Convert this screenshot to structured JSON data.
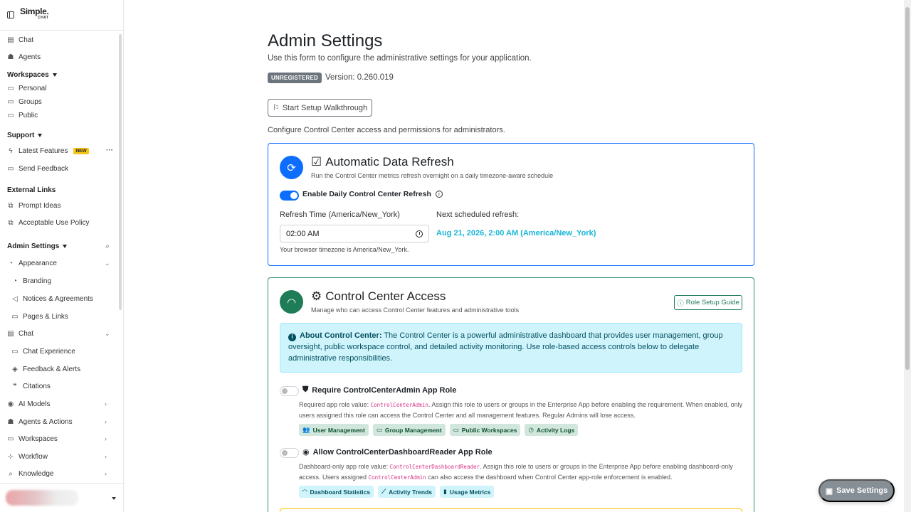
{
  "brand": {
    "line1": "Simple.",
    "line2": "CHAT"
  },
  "sidebar": {
    "chat": "Chat",
    "agents": "Agents",
    "workspaces_header": "Workspaces",
    "personal": "Personal",
    "groups": "Groups",
    "public": "Public",
    "support_header": "Support",
    "latest_features": "Latest Features",
    "new_badge": "NEW",
    "more": "···",
    "send_feedback": "Send Feedback",
    "external_links_header": "External Links",
    "prompt_ideas": "Prompt Ideas",
    "acceptable_use": "Acceptable Use Policy",
    "admin_header": "Admin Settings",
    "appearance": "Appearance",
    "branding": "Branding",
    "notices": "Notices & Agreements",
    "pages_links": "Pages & Links",
    "chat_group": "Chat",
    "chat_experience": "Chat Experience",
    "feedback_alerts": "Feedback & Alerts",
    "citations": "Citations",
    "ai_models": "AI Models",
    "agents_actions": "Agents & Actions",
    "workspaces_group": "Workspaces",
    "workflow": "Workflow",
    "knowledge": "Knowledge"
  },
  "page": {
    "title": "Admin Settings",
    "subtitle": "Use this form to configure the administrative settings for your application.",
    "badge": "UNREGISTERED",
    "version": "Version: 0.260.019",
    "walkthrough": "Start Setup Walkthrough",
    "configure_text": "Configure Control Center access and permissions for administrators."
  },
  "refresh": {
    "title": "Automatic Data Refresh",
    "subtitle": "Run the Control Center metrics refresh overnight on a daily timezone-aware schedule",
    "toggle_label": "Enable Daily Control Center Refresh",
    "toggle_on": true,
    "time_label": "Refresh Time (America/New_York)",
    "time_value": "02:00  AM",
    "browser_tz": "Your browser timezone is America/New_York.",
    "next_label": "Next scheduled refresh:",
    "next_value": "Aug 21, 2026, 2:00 AM (America/New_York)"
  },
  "access": {
    "title": "Control Center Access",
    "subtitle": "Manage who can access Control Center features and administrative tools",
    "guide_button": "Role Setup Guide",
    "alert_bold": "About Control Center:",
    "alert_text": " The Control Center is a powerful administrative dashboard that provides user management, group oversight, public workspace control, and detailed activity monitoring. Use role-based access controls below to delegate administrative responsibilities.",
    "role1": {
      "title": "Require ControlCenterAdmin App Role",
      "enabled": false,
      "text_a": "Required app role value: ",
      "code": "ControlCenterAdmin",
      "text_b": ". Assign this role to users or groups in the Enterprise App before enabling the requirement. When enabled, only users assigned this role can access the Control Center and all management features. Regular Admins will lose access.",
      "pills": [
        "User Management",
        "Group Management",
        "Public Workspaces",
        "Activity Logs"
      ]
    },
    "role2": {
      "title": "Allow ControlCenterDashboardReader App Role",
      "enabled": false,
      "text_a": "Dashboard-only app role value: ",
      "code": "ControlCenterDashboardReader",
      "text_b": ". Assign this role to users or groups in the Enterprise App before enabling dashboard-only access. Users assigned ",
      "code2": "ControlCenterAdmin",
      "text_c": " can also access the dashboard when Control Center app-role enforcement is enabled.",
      "pills": [
        "Dashboard Statistics",
        "Activity Trends",
        "Usage Metrics"
      ]
    }
  },
  "save_button": "Save Settings",
  "colors": {
    "primary": "#0d6efd",
    "success": "#1e7c56",
    "info_bg": "#cff4fc",
    "info_text": "#17b5d8"
  }
}
